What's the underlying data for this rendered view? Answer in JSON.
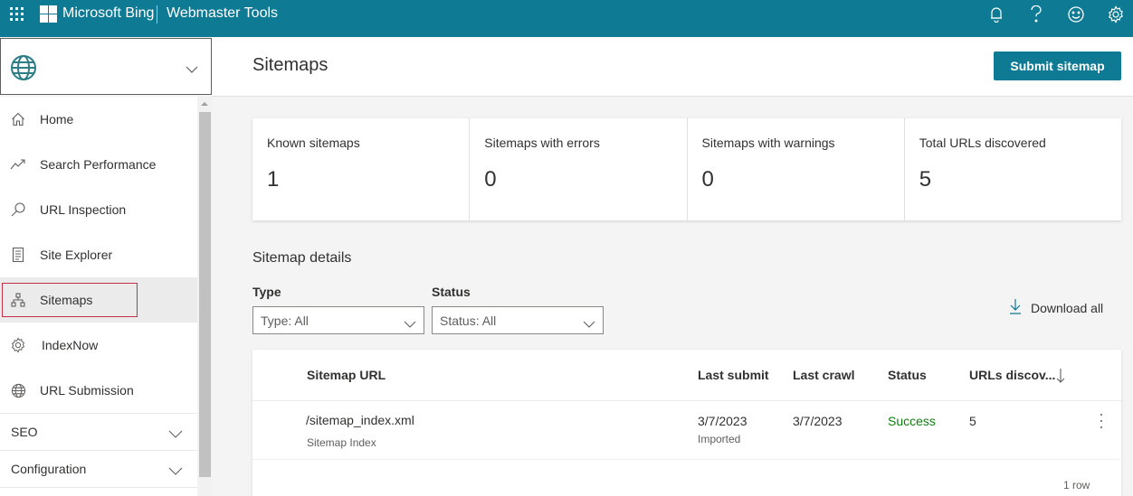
{
  "topbar": {
    "brand": "Microsoft Bing",
    "product": "Webmaster Tools",
    "icons": [
      "waffle-icon",
      "microsoft-logo",
      "bell-icon",
      "help-icon",
      "feedback-smiley-icon",
      "settings-gear-icon"
    ],
    "color": "#0e7a93"
  },
  "site_selector": {
    "value": "",
    "icon": "globe-icon"
  },
  "sidebar": {
    "items": [
      {
        "label": "Home",
        "icon": "home-icon"
      },
      {
        "label": "Search Performance",
        "icon": "trend-chart-icon"
      },
      {
        "label": "URL Inspection",
        "icon": "search-icon"
      },
      {
        "label": "Site Explorer",
        "icon": "document-list-icon"
      },
      {
        "label": "Sitemaps",
        "icon": "sitemap-icon",
        "active": true
      },
      {
        "label": "IndexNow",
        "icon": "gear-icon"
      },
      {
        "label": "URL Submission",
        "icon": "globe-icon"
      }
    ],
    "groups": [
      {
        "label": "SEO"
      },
      {
        "label": "Configuration"
      }
    ]
  },
  "page": {
    "title": "Sitemaps",
    "submit_label": "Submit sitemap"
  },
  "stats": [
    {
      "label": "Known sitemaps",
      "value": "1"
    },
    {
      "label": "Sitemaps with errors",
      "value": "0"
    },
    {
      "label": "Sitemaps with warnings",
      "value": "0"
    },
    {
      "label": "Total URLs discovered",
      "value": "5"
    }
  ],
  "details": {
    "title": "Sitemap details",
    "filters": {
      "type": {
        "label": "Type",
        "value": "Type: All"
      },
      "status": {
        "label": "Status",
        "value": "Status: All"
      }
    },
    "download_all": "Download all"
  },
  "table": {
    "columns": [
      "Sitemap URL",
      "Last submit",
      "Last crawl",
      "Status",
      "URLs discov..."
    ],
    "sort_column": "URLs discov...",
    "sort_direction": "descending",
    "rows": [
      {
        "url": "/sitemap_index.xml",
        "type": "Sitemap Index",
        "last_submit": "3/7/2023",
        "submit_source": "Imported",
        "last_crawl": "3/7/2023",
        "status": "Success",
        "urls_discovered": "5"
      }
    ],
    "row_count": "1 row"
  }
}
